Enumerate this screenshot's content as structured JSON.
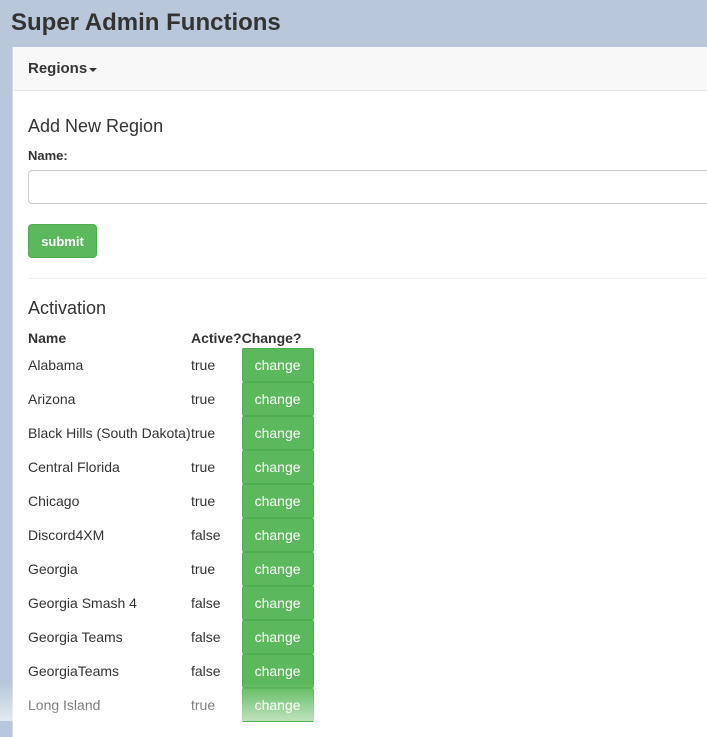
{
  "page_title": "Super Admin Functions",
  "navbar": {
    "dropdown_label": "Regions"
  },
  "add_region": {
    "heading": "Add New Region",
    "name_label": "Name:",
    "name_value": "",
    "submit_label": "submit"
  },
  "activation": {
    "heading": "Activation",
    "headers": {
      "name": "Name",
      "active": "Active?",
      "change": "Change?"
    },
    "change_label": "change",
    "rows": [
      {
        "name": "Alabama",
        "active": "true"
      },
      {
        "name": "Arizona",
        "active": "true"
      },
      {
        "name": "Black Hills (South Dakota)",
        "active": "true"
      },
      {
        "name": "Central Florida",
        "active": "true"
      },
      {
        "name": "Chicago",
        "active": "true"
      },
      {
        "name": "Discord4XM",
        "active": "false"
      },
      {
        "name": "Georgia",
        "active": "true"
      },
      {
        "name": "Georgia Smash 4",
        "active": "false"
      },
      {
        "name": "Georgia Teams",
        "active": "false"
      },
      {
        "name": "GeorgiaTeams",
        "active": "false"
      },
      {
        "name": "Long Island",
        "active": "true"
      }
    ]
  },
  "colors": {
    "button_green": "#5cb85c",
    "background": "#b8c8da"
  }
}
